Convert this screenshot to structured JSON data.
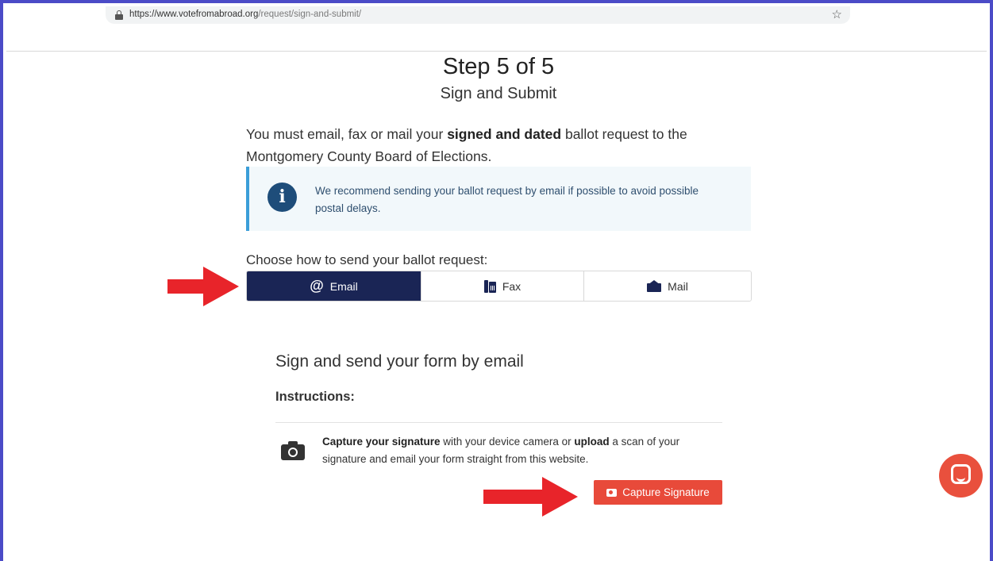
{
  "browser": {
    "url_host": "https://www.votefromabroad.org",
    "url_path": "/request/sign-and-submit/"
  },
  "header": {
    "step": "Step 5 of 5",
    "subtitle": "Sign and Submit"
  },
  "intro": {
    "pre": "You must email, fax or mail your ",
    "bold": "signed and dated",
    "post": " ballot request to the Montgomery County Board of Elections."
  },
  "info": {
    "icon": "info-icon",
    "text": "We recommend sending your ballot request by email if possible to avoid possible postal delays."
  },
  "send_method": {
    "label": "Choose how to send your ballot request:",
    "options": [
      {
        "label": "Email",
        "icon": "at-icon",
        "selected": true
      },
      {
        "label": "Fax",
        "icon": "fax-icon",
        "selected": false
      },
      {
        "label": "Mail",
        "icon": "envelope-open-icon",
        "selected": false
      }
    ]
  },
  "email_section": {
    "title": "Sign and send your form by email",
    "instructions_label": "Instructions:",
    "capture_bold_1": "Capture your signature",
    "capture_mid": " with your device camera or ",
    "capture_bold_2": "upload",
    "capture_post": " a scan of your signature and email your form straight from this website.",
    "button_label": "Capture Signature"
  },
  "colors": {
    "active_tab": "#1a2555",
    "info_border": "#3b9ed8",
    "capture_button": "#e84a3a",
    "annotation_arrow": "#e8242a",
    "frame": "#4b4bc7"
  }
}
